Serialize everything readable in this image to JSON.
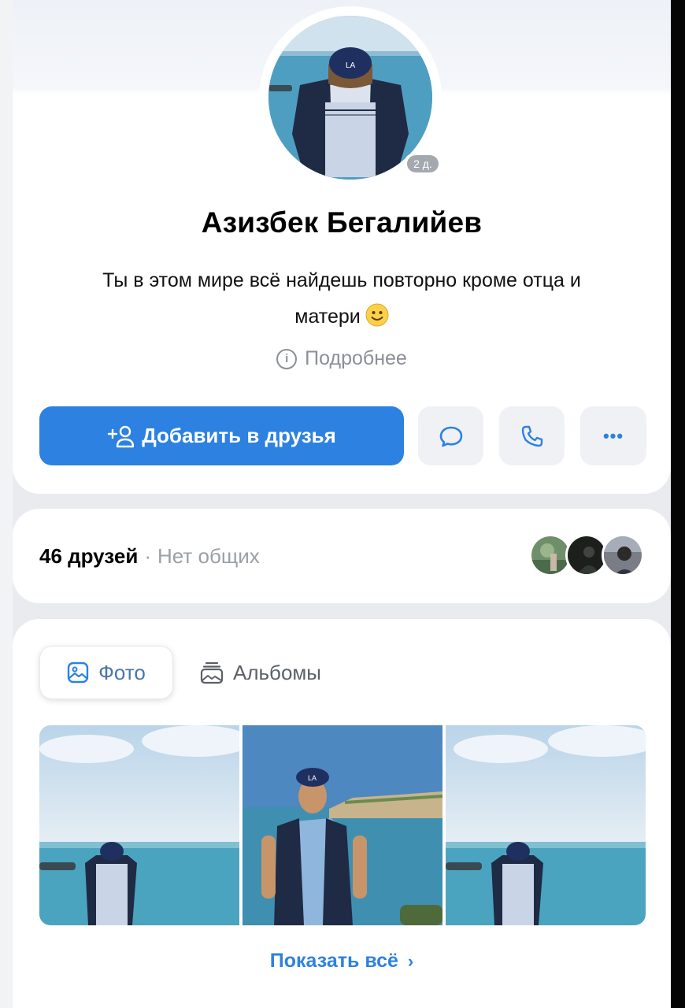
{
  "profile": {
    "name": "Азизбек Бегалийев",
    "status_text": "Ты в этом мире всё найдешь повторно кроме отца и матери",
    "online_badge": "2 д.",
    "more_info_label": "Подробнее",
    "more_info_icon": "info-icon",
    "avatar_icon": "profile-avatar-photo"
  },
  "actions": {
    "add_friend_label": "Добавить в друзья",
    "add_friend_icon": "add-person-icon",
    "message_icon": "message-icon",
    "call_icon": "phone-icon",
    "more_label": "•••"
  },
  "friends": {
    "count_label": "46 друзей",
    "separator": "·",
    "mutual_label": "Нет общих"
  },
  "photos": {
    "tabs": [
      {
        "label": "Фото",
        "icon": "photo-icon",
        "active": true
      },
      {
        "label": "Альбомы",
        "icon": "album-icon",
        "active": false
      }
    ],
    "show_all_label": "Показать всё",
    "show_all_chevron": "›"
  },
  "colors": {
    "accent": "#2d81e0",
    "muted": "#8b9097",
    "tab_text": "#4a76a8"
  }
}
